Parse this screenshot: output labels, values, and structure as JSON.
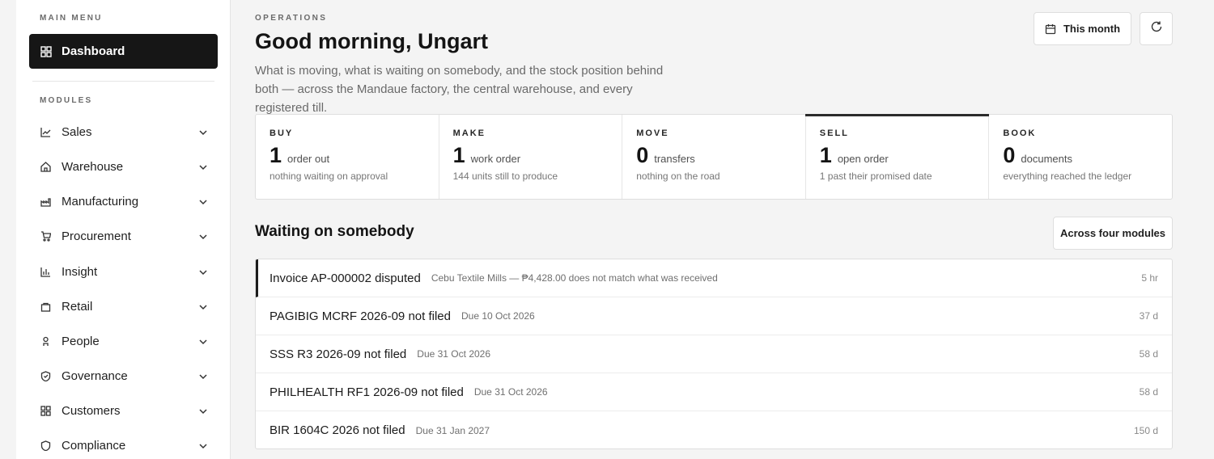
{
  "sidebar": {
    "main_heading": "MAIN MENU",
    "dashboard_label": "Dashboard",
    "modules_heading": "MODULES",
    "modules": [
      {
        "label": "Sales",
        "icon": "chart-line-icon"
      },
      {
        "label": "Warehouse",
        "icon": "home-icon"
      },
      {
        "label": "Manufacturing",
        "icon": "factory-icon"
      },
      {
        "label": "Procurement",
        "icon": "cart-icon"
      },
      {
        "label": "Insight",
        "icon": "bar-chart-icon"
      },
      {
        "label": "Retail",
        "icon": "bag-icon"
      },
      {
        "label": "People",
        "icon": "person-icon"
      },
      {
        "label": "Governance",
        "icon": "shield-check-icon"
      },
      {
        "label": "Customers",
        "icon": "grid-icon"
      },
      {
        "label": "Compliance",
        "icon": "shield-icon"
      }
    ]
  },
  "header": {
    "eyebrow": "OPERATIONS",
    "greeting": "Good morning, Ungart",
    "intro": "What is moving, what is waiting on somebody, and the stock position behind both — across the Mandaue factory, the central warehouse, and every registered till.",
    "period_label": "This month"
  },
  "kpis": [
    {
      "label": "BUY",
      "value": "1",
      "unit": "order out",
      "sub": "nothing waiting on approval"
    },
    {
      "label": "MAKE",
      "value": "1",
      "unit": "work order",
      "sub": "144 units still to produce"
    },
    {
      "label": "MOVE",
      "value": "0",
      "unit": "transfers",
      "sub": "nothing on the road"
    },
    {
      "label": "SELL",
      "value": "1",
      "unit": "open order",
      "sub": "1 past their promised date"
    },
    {
      "label": "BOOK",
      "value": "0",
      "unit": "documents",
      "sub": "everything reached the ledger"
    }
  ],
  "waiting": {
    "title": "Waiting on somebody",
    "scope_label": "Across four modules",
    "items": [
      {
        "title": "Invoice AP-000002 disputed",
        "detail": "Cebu Textile Mills — ₱4,428.00 does not match what was received",
        "age": "5 hr"
      },
      {
        "title": "PAGIBIG MCRF 2026-09 not filed",
        "detail": "Due 10 Oct 2026",
        "age": "37 d"
      },
      {
        "title": "SSS R3 2026-09 not filed",
        "detail": "Due 31 Oct 2026",
        "age": "58 d"
      },
      {
        "title": "PHILHEALTH RF1 2026-09 not filed",
        "detail": "Due 31 Oct 2026",
        "age": "58 d"
      },
      {
        "title": "BIR 1604C 2026 not filed",
        "detail": "Due 31 Jan 2027",
        "age": "150 d"
      }
    ]
  },
  "colors": {
    "accent": "#161616",
    "background": "#f4f4f4",
    "surface": "#ffffff"
  }
}
